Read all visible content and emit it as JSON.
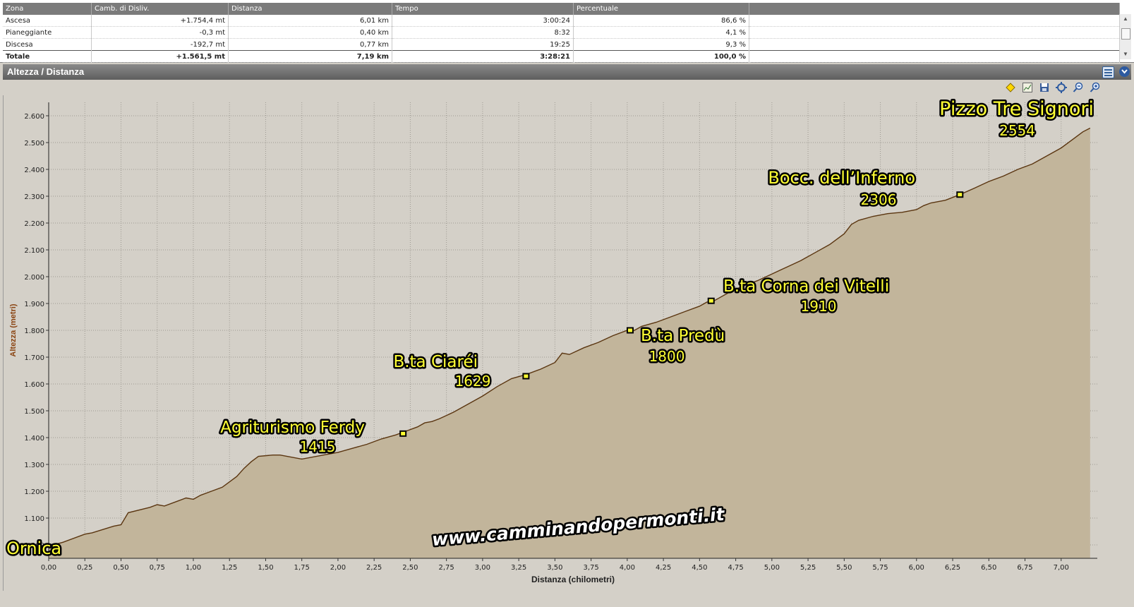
{
  "stats_table": {
    "headers": [
      "Zona",
      "Camb. di Disliv.",
      "Distanza",
      "Tempo",
      "Percentuale"
    ],
    "rows": [
      [
        "Ascesa",
        "+1.754,4 mt",
        "6,01 km",
        "3:00:24",
        "86,6 %"
      ],
      [
        "Pianeggiante",
        "-0,3 mt",
        "0,40 km",
        "8:32",
        "4,1 %"
      ],
      [
        "Discesa",
        "-192,7 mt",
        "0,77 km",
        "19:25",
        "9,3 %"
      ]
    ],
    "total": [
      "Totale",
      "+1.561,5 mt",
      "7,19 km",
      "3:28:21",
      "100,0 %"
    ]
  },
  "panel": {
    "title": "Altezza / Distanza",
    "icons": {
      "layout": "layout-icon",
      "collapse": "collapse-icon",
      "toolbar": [
        "marker-icon",
        "chart-icon",
        "save-icon",
        "fit-icon",
        "zoom-out-icon",
        "zoom-in-icon"
      ]
    }
  },
  "colors": {
    "fill": "#c2b59b",
    "line": "#5a3510",
    "label_fill": "#ffff33",
    "label_stroke": "#000000",
    "axis_label": "#8b4513",
    "plot_bg": "#d4d0c8"
  },
  "watermark": "www.camminandopermonti.it",
  "chart_data": {
    "type": "area",
    "xlabel": "Distanza (chilometri)",
    "ylabel": "Altezza (metri)",
    "xlim": [
      0,
      7.2
    ],
    "ylim": [
      950,
      2650
    ],
    "grid": true,
    "x_ticks": [
      "0,00",
      "0,25",
      "0,50",
      "0,75",
      "1,00",
      "1,25",
      "1,50",
      "1,75",
      "2,00",
      "2,25",
      "2,50",
      "2,75",
      "3,00",
      "3,25",
      "3,50",
      "3,75",
      "4,00",
      "4,25",
      "4,50",
      "4,75",
      "5,00",
      "5,25",
      "5,50",
      "5,75",
      "6,00",
      "6,25",
      "6,50",
      "6,75",
      "7,00"
    ],
    "y_ticks": [
      "1.000",
      "1.100",
      "1.200",
      "1.300",
      "1.400",
      "1.500",
      "1.600",
      "1.700",
      "1.800",
      "1.900",
      "2.000",
      "2.100",
      "2.200",
      "2.300",
      "2.400",
      "2.500",
      "2.600"
    ],
    "x": [
      0.0,
      0.1,
      0.25,
      0.3,
      0.45,
      0.5,
      0.55,
      0.7,
      0.75,
      0.8,
      0.9,
      0.95,
      1.0,
      1.05,
      1.1,
      1.2,
      1.3,
      1.35,
      1.4,
      1.45,
      1.55,
      1.6,
      1.75,
      1.9,
      2.0,
      2.1,
      2.2,
      2.3,
      2.4,
      2.45,
      2.55,
      2.6,
      2.65,
      2.7,
      2.8,
      2.9,
      3.0,
      3.1,
      3.2,
      3.3,
      3.4,
      3.5,
      3.55,
      3.6,
      3.7,
      3.8,
      3.9,
      4.0,
      4.05,
      4.1,
      4.2,
      4.3,
      4.4,
      4.5,
      4.55,
      4.6,
      4.7,
      4.8,
      4.9,
      5.0,
      5.1,
      5.2,
      5.3,
      5.4,
      5.5,
      5.55,
      5.6,
      5.7,
      5.8,
      5.9,
      6.0,
      6.05,
      6.1,
      6.2,
      6.3,
      6.4,
      6.5,
      6.6,
      6.7,
      6.8,
      6.9,
      7.0,
      7.1,
      7.15,
      7.2
    ],
    "values": [
      995,
      1010,
      1040,
      1045,
      1070,
      1075,
      1120,
      1140,
      1150,
      1145,
      1165,
      1175,
      1170,
      1185,
      1195,
      1215,
      1255,
      1285,
      1310,
      1330,
      1335,
      1335,
      1320,
      1335,
      1345,
      1360,
      1375,
      1395,
      1410,
      1420,
      1440,
      1455,
      1460,
      1470,
      1495,
      1525,
      1555,
      1590,
      1620,
      1635,
      1655,
      1680,
      1715,
      1710,
      1735,
      1755,
      1780,
      1800,
      1800,
      1815,
      1830,
      1850,
      1870,
      1890,
      1905,
      1910,
      1940,
      1965,
      1985,
      2010,
      2035,
      2060,
      2090,
      2120,
      2160,
      2195,
      2210,
      2225,
      2235,
      2240,
      2250,
      2265,
      2275,
      2285,
      2306,
      2330,
      2355,
      2375,
      2400,
      2420,
      2450,
      2480,
      2520,
      2540,
      2554
    ],
    "annotations": [
      {
        "name": "Ornica",
        "elevation": ""
      },
      {
        "name": "Agriturismo Ferdy",
        "elevation": "1415",
        "x": 2.45,
        "y": 1415
      },
      {
        "name": "B.ta Ciaréi",
        "elevation": "1629",
        "x": 3.3,
        "y": 1629
      },
      {
        "name": "B.ta Predù",
        "elevation": "1800",
        "x": 4.02,
        "y": 1800
      },
      {
        "name": "B.ta Corna dei Vitelli",
        "elevation": "1910",
        "x": 4.58,
        "y": 1910
      },
      {
        "name": "Bocc. dell’Inferno",
        "elevation": "2306",
        "x": 6.3,
        "y": 2306
      },
      {
        "name": "Pizzo Tre Signori",
        "elevation": "2554"
      }
    ]
  }
}
